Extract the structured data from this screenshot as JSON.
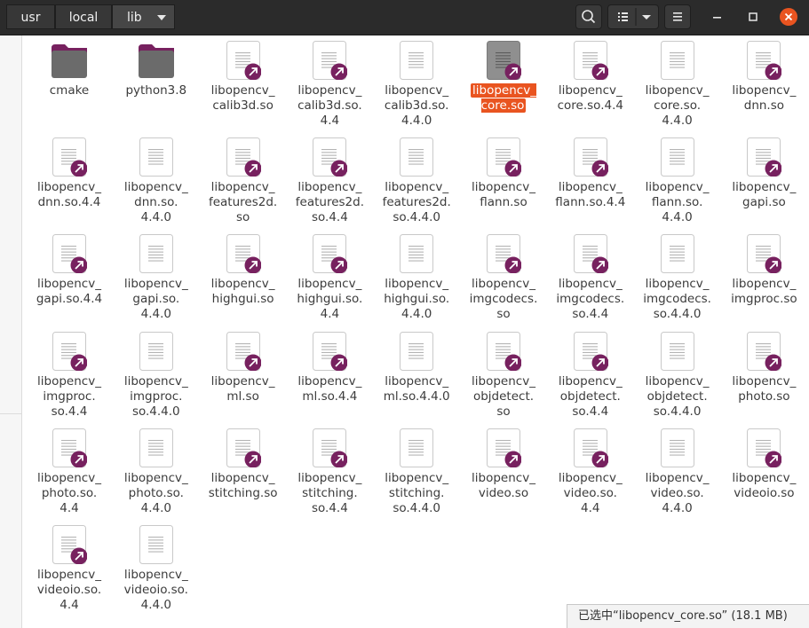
{
  "breadcrumbs": [
    "usr",
    "local",
    "lib"
  ],
  "colors": {
    "accent": "#e95420",
    "link_badge": "#77215f",
    "close": "#e95420"
  },
  "files": [
    {
      "name": "cmake",
      "kind": "folder"
    },
    {
      "name": "python3.8",
      "kind": "folder"
    },
    {
      "name": "libopencv_\ncalib3d.so",
      "kind": "link"
    },
    {
      "name": "libopencv_\ncalib3d.so.\n4.4",
      "kind": "link"
    },
    {
      "name": "libopencv_\ncalib3d.so.\n4.4.0",
      "kind": "file"
    },
    {
      "name": "libopencv_\ncore.so",
      "kind": "link",
      "selected": true
    },
    {
      "name": "libopencv_\ncore.so.4.4",
      "kind": "link"
    },
    {
      "name": "libopencv_\ncore.so.\n4.4.0",
      "kind": "file"
    },
    {
      "name": "libopencv_\ndnn.so",
      "kind": "link"
    },
    {
      "name": "libopencv_\ndnn.so.4.4",
      "kind": "link"
    },
    {
      "name": "libopencv_\ndnn.so.\n4.4.0",
      "kind": "file"
    },
    {
      "name": "libopencv_\nfeatures2d.\nso",
      "kind": "link"
    },
    {
      "name": "libopencv_\nfeatures2d.\nso.4.4",
      "kind": "link"
    },
    {
      "name": "libopencv_\nfeatures2d.\nso.4.4.0",
      "kind": "file"
    },
    {
      "name": "libopencv_\nflann.so",
      "kind": "link"
    },
    {
      "name": "libopencv_\nflann.so.4.4",
      "kind": "link"
    },
    {
      "name": "libopencv_\nflann.so.\n4.4.0",
      "kind": "file"
    },
    {
      "name": "libopencv_\ngapi.so",
      "kind": "link"
    },
    {
      "name": "libopencv_\ngapi.so.4.4",
      "kind": "link"
    },
    {
      "name": "libopencv_\ngapi.so.\n4.4.0",
      "kind": "file"
    },
    {
      "name": "libopencv_\nhighgui.so",
      "kind": "link"
    },
    {
      "name": "libopencv_\nhighgui.so.\n4.4",
      "kind": "link"
    },
    {
      "name": "libopencv_\nhighgui.so.\n4.4.0",
      "kind": "file"
    },
    {
      "name": "libopencv_\nimgcodecs.\nso",
      "kind": "link"
    },
    {
      "name": "libopencv_\nimgcodecs.\nso.4.4",
      "kind": "link"
    },
    {
      "name": "libopencv_\nimgcodecs.\nso.4.4.0",
      "kind": "file"
    },
    {
      "name": "libopencv_\nimgproc.so",
      "kind": "link"
    },
    {
      "name": "libopencv_\nimgproc.\nso.4.4",
      "kind": "link"
    },
    {
      "name": "libopencv_\nimgproc.\nso.4.4.0",
      "kind": "file"
    },
    {
      "name": "libopencv_\nml.so",
      "kind": "link"
    },
    {
      "name": "libopencv_\nml.so.4.4",
      "kind": "link"
    },
    {
      "name": "libopencv_\nml.so.4.4.0",
      "kind": "file"
    },
    {
      "name": "libopencv_\nobjdetect.\nso",
      "kind": "link"
    },
    {
      "name": "libopencv_\nobjdetect.\nso.4.4",
      "kind": "link"
    },
    {
      "name": "libopencv_\nobjdetect.\nso.4.4.0",
      "kind": "file"
    },
    {
      "name": "libopencv_\nphoto.so",
      "kind": "link"
    },
    {
      "name": "libopencv_\nphoto.so.\n4.4",
      "kind": "link"
    },
    {
      "name": "libopencv_\nphoto.so.\n4.4.0",
      "kind": "file"
    },
    {
      "name": "libopencv_\nstitching.so",
      "kind": "link"
    },
    {
      "name": "libopencv_\nstitching.\nso.4.4",
      "kind": "link"
    },
    {
      "name": "libopencv_\nstitching.\nso.4.4.0",
      "kind": "file"
    },
    {
      "name": "libopencv_\nvideo.so",
      "kind": "link"
    },
    {
      "name": "libopencv_\nvideo.so.\n4.4",
      "kind": "link"
    },
    {
      "name": "libopencv_\nvideo.so.\n4.4.0",
      "kind": "file"
    },
    {
      "name": "libopencv_\nvideoio.so",
      "kind": "link"
    },
    {
      "name": "libopencv_\nvideoio.so.\n4.4",
      "kind": "link"
    },
    {
      "name": "libopencv_\nvideoio.so.\n4.4.0",
      "kind": "file"
    }
  ],
  "status": "已选中“libopencv_core.so” (18.1 MB)"
}
